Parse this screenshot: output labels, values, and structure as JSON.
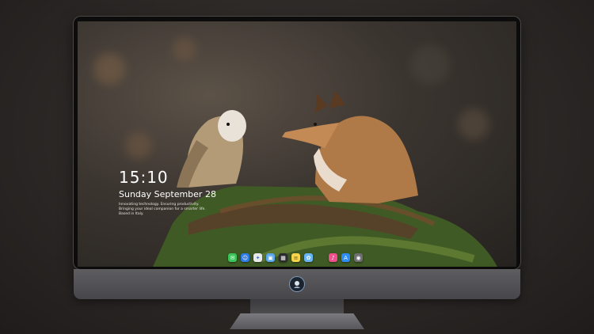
{
  "lock_screen": {
    "time": "15:10",
    "date": "Sunday September 28",
    "note": "Innovating technology. Ensuring productivity. Bringing your ideal companion for a smarter life. Based in Italy."
  },
  "dock": {
    "items": [
      {
        "name": "messages-icon",
        "color": "#3cc35b",
        "glyph": "✉"
      },
      {
        "name": "finder-icon",
        "color": "#2d7be4",
        "glyph": "☺"
      },
      {
        "name": "safari-icon",
        "color": "#e9e9ea",
        "glyph": "✦"
      },
      {
        "name": "preview-icon",
        "color": "#5aa6e8",
        "glyph": "▣"
      },
      {
        "name": "clapper-icon",
        "color": "#2b2b2d",
        "glyph": "▦"
      },
      {
        "name": "notes-icon",
        "color": "#f5d34c",
        "glyph": "≡"
      },
      {
        "name": "photos-icon",
        "color": "#67b6f3",
        "glyph": "✿"
      },
      {
        "name": "music-icon",
        "color": "#f04f8d",
        "glyph": "♪"
      },
      {
        "name": "app-store-icon",
        "color": "#2e8df5",
        "glyph": "A"
      },
      {
        "name": "camera-icon",
        "color": "#6e6e72",
        "glyph": "◉"
      }
    ]
  },
  "colors": {
    "bezel": "#0c0c0d",
    "chin": "#5e5d60",
    "background": "#2c2826"
  }
}
